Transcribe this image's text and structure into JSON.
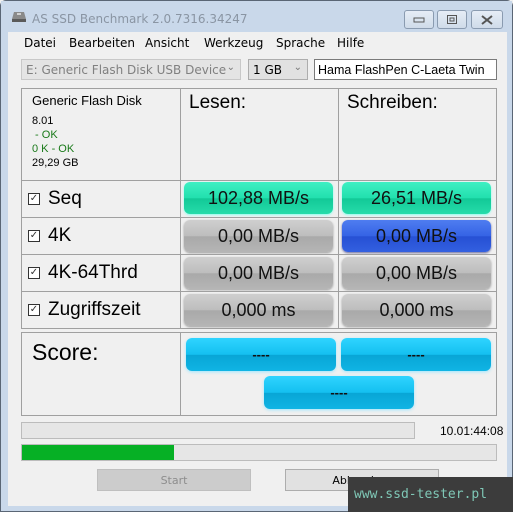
{
  "window": {
    "title": "AS SSD Benchmark 2.0.7316.34247",
    "controls": {
      "minimize": "minimize",
      "maximize": "maximize",
      "close": "close"
    }
  },
  "menu": {
    "items": [
      "Datei",
      "Bearbeiten",
      "Ansicht",
      "Werkzeug",
      "Sprache",
      "Hilfe"
    ]
  },
  "toolbar": {
    "drive": "E: Generic Flash Disk USB Device",
    "size": "1 GB",
    "name_value": "Hama FlashPen C-Laeta Twin"
  },
  "drive_info": {
    "name": "Generic Flash Disk",
    "firmware": "8.01",
    "driver_status": " - OK",
    "alignment": "0 K - OK",
    "capacity": "29,29 GB"
  },
  "headers": {
    "read": "Lesen:",
    "write": "Schreiben:"
  },
  "tests": [
    {
      "label": "Seq",
      "checked": true,
      "read": "102,88 MB/s",
      "write": "26,51 MB/s",
      "read_color": "green",
      "write_color": "green"
    },
    {
      "label": "4K",
      "checked": true,
      "read": "0,00 MB/s",
      "write": "0,00 MB/s",
      "read_color": "gray",
      "write_color": "blue"
    },
    {
      "label": "4K-64Thrd",
      "checked": true,
      "read": "0,00 MB/s",
      "write": "0,00 MB/s",
      "read_color": "gray",
      "write_color": "gray"
    },
    {
      "label": "Zugriffszeit",
      "checked": true,
      "read": "0,000 ms",
      "write": "0,000 ms",
      "read_color": "gray",
      "write_color": "gray"
    }
  ],
  "score": {
    "label": "Score:",
    "read": "----",
    "write": "----",
    "total": "----"
  },
  "status": {
    "elapsed": "10.01:44:08",
    "top_progress_percent": 0,
    "bottom_progress_percent": 32
  },
  "buttons": {
    "start": "Start",
    "abort": "Abbrechen"
  },
  "watermark": "www.ssd-tester.pl",
  "colors": {
    "progress": "#06b025",
    "green": "#22e0ae",
    "blue": "#3563e5",
    "cyan": "#14c0f0",
    "ok_text": "#1a7a1a"
  }
}
